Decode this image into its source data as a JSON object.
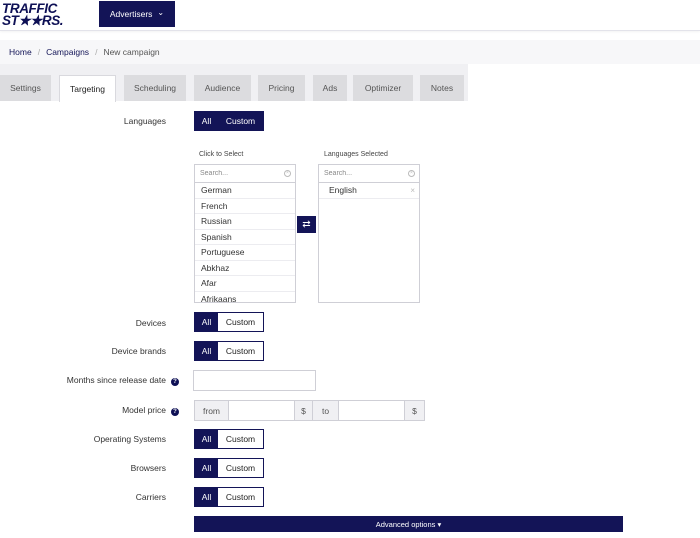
{
  "header": {
    "logo_line1": "TRAFFIC",
    "logo_line2": "ST★★RS.",
    "advertisers_label": "Advertisers",
    "advertisers_caret": "⌄"
  },
  "breadcrumb": {
    "home": "Home",
    "campaigns": "Campaigns",
    "current": "New campaign",
    "separator": "/"
  },
  "tabs": [
    {
      "label": "Settings",
      "active": false
    },
    {
      "label": "Targeting",
      "active": true
    },
    {
      "label": "Scheduling",
      "active": false
    },
    {
      "label": "Audience",
      "active": false
    },
    {
      "label": "Pricing",
      "active": false
    },
    {
      "label": "Ads",
      "active": false
    },
    {
      "label": "Optimizer",
      "active": false
    },
    {
      "label": "Notes",
      "active": false
    }
  ],
  "toggle": {
    "all": "All",
    "custom": "Custom"
  },
  "languages": {
    "label": "Languages",
    "selected_mode": "custom",
    "available_caption": "Click to Select",
    "selected_caption": "Languages Selected",
    "search_placeholder": "Search...",
    "available": [
      "German",
      "French",
      "Russian",
      "Spanish",
      "Portuguese",
      "Abkhaz",
      "Afar",
      "Afrikaans"
    ],
    "selected": [
      "English"
    ],
    "remove_glyph": "×",
    "swap_glyph": "⇄"
  },
  "rows": {
    "devices": "Devices",
    "device_brands": "Device brands",
    "months_since_release": "Months since release date",
    "model_price": "Model price",
    "operating_systems": "Operating Systems",
    "browsers": "Browsers",
    "carriers": "Carriers"
  },
  "help_glyph": "?",
  "model_price": {
    "from": "from",
    "to": "to",
    "currency": "$"
  },
  "advanced_options": "Advanced options ▾",
  "colors": {
    "primary": "#131457",
    "tab_bg": "#dcdcdf",
    "page_bg": "#ffffff"
  }
}
